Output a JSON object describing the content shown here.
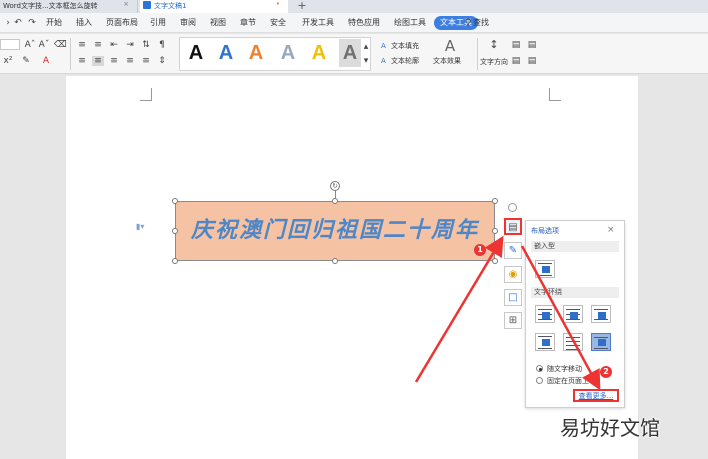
{
  "tabs": [
    {
      "label": "Word文字技...文本框怎么旋转",
      "close": "×"
    },
    {
      "label": "文字文稿1",
      "close": "•"
    }
  ],
  "new_tab": "+",
  "menu": {
    "items": [
      "开始",
      "插入",
      "页面布局",
      "引用",
      "审阅",
      "视图",
      "章节",
      "安全",
      "开发工具",
      "特色应用",
      "绘图工具",
      "文本工具"
    ],
    "active": "文本工具",
    "search": "查找"
  },
  "ribbon": {
    "style_letters": [
      "A",
      "A",
      "A",
      "A",
      "A",
      "A"
    ],
    "style_colors": [
      "#111111",
      "#2e75c9",
      "#f08030",
      "#9aa8bd",
      "#f0c000",
      "#707070"
    ],
    "text_fill": "文本填充",
    "text_outline": "文本轮廓",
    "text_effects": "文本效果",
    "text_direction": "文字方向",
    "effects_glyph": "A"
  },
  "document": {
    "textbox_text": "庆祝澳门回归祖国二十周年",
    "textbox_fill": "#f5c3a4",
    "text_color": "#4f86c6"
  },
  "panel": {
    "title": "布局选项",
    "close": "×",
    "inline_label": "嵌入型",
    "wrap_label": "文字环绕",
    "option_move": "随文字移动",
    "option_fixed": "固定在页面上",
    "see_more": "查看更多..."
  },
  "badges": [
    "1",
    "2"
  ],
  "watermark": "易坊好文馆"
}
